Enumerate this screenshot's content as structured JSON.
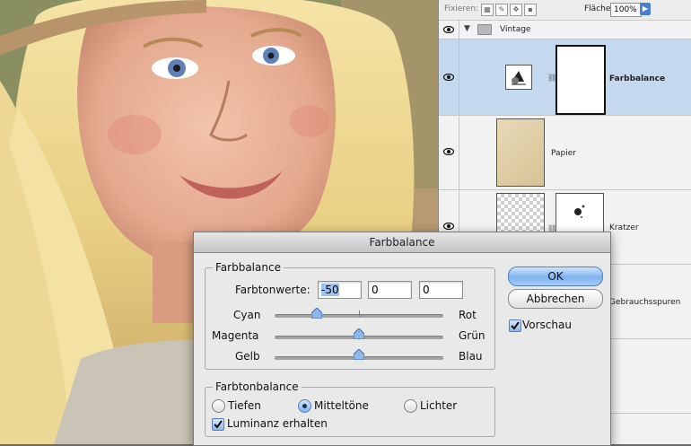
{
  "layers_panel": {
    "lock_label": "Fixieren:",
    "opacity_label": "Fläche:",
    "opacity_value": "100%",
    "layers": [
      {
        "name": "Vintage",
        "type": "group",
        "visible": true
      },
      {
        "name": "Farbbalance",
        "type": "adjustment",
        "visible": true,
        "selected": true
      },
      {
        "name": "Papier",
        "type": "pixel",
        "visible": true
      },
      {
        "name": "Kratzer",
        "type": "masked",
        "visible": true
      },
      {
        "name": "Gebrauchsspuren",
        "type": "pixel",
        "visible": true
      }
    ]
  },
  "dialog": {
    "title": "Farbbalance",
    "color_balance": {
      "legend": "Farbbalance",
      "levels_label": "Farbtonwerte:",
      "levels": [
        "-50",
        "0",
        "0"
      ],
      "sliders": [
        {
          "left": "Cyan",
          "right": "Rot",
          "value": -50
        },
        {
          "left": "Magenta",
          "right": "Grün",
          "value": 0
        },
        {
          "left": "Gelb",
          "right": "Blau",
          "value": 0
        }
      ]
    },
    "tone_balance": {
      "legend": "Farbtonbalance",
      "options": [
        "Tiefen",
        "Mitteltöne",
        "Lichter"
      ],
      "selected": "Mitteltöne",
      "preserve_luminosity_label": "Luminanz erhalten",
      "preserve_luminosity": true
    },
    "ok_label": "OK",
    "cancel_label": "Abbrechen",
    "preview_label": "Vorschau",
    "preview": true
  },
  "colors": {
    "selection": "#c4d8ee",
    "accent": "#7fb2ee",
    "panel": "#f2f2f2",
    "dialog": "#e9e9e9"
  }
}
